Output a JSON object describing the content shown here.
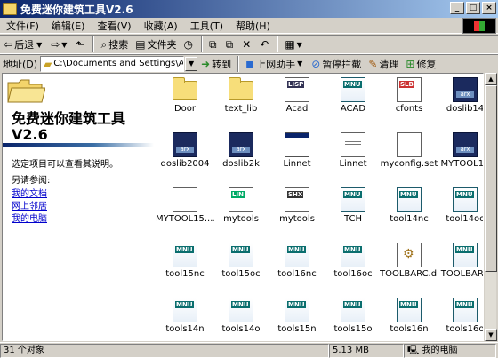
{
  "window": {
    "title": "免费迷你建筑工具V2.6"
  },
  "menu": [
    "文件(F)",
    "编辑(E)",
    "查看(V)",
    "收藏(A)",
    "工具(T)",
    "帮助(H)"
  ],
  "toolbar": {
    "back": "后退",
    "search": "搜索",
    "folders": "文件夹"
  },
  "address": {
    "label": "地址(D)",
    "value": "C:\\Documents and Settings\\Administ",
    "go": "转到",
    "links": [
      "上网助手",
      "暂停拦截",
      "清理",
      "修复"
    ]
  },
  "leftpane": {
    "title": "免费迷你建筑工具 V2.6",
    "desc": "选定项目可以查看其说明。",
    "see_also": "另请参阅:",
    "links": [
      "我的文档",
      "网上邻居",
      "我的电脑"
    ]
  },
  "files": [
    {
      "name": "Door",
      "type": "folder"
    },
    {
      "name": "text_lib",
      "type": "folder"
    },
    {
      "name": "Acad",
      "type": "lisp"
    },
    {
      "name": "ACAD",
      "type": "mnu"
    },
    {
      "name": "cfonts",
      "type": "slb"
    },
    {
      "name": "doslib14",
      "type": "arx"
    },
    {
      "name": "doslib2004",
      "type": "arx"
    },
    {
      "name": "doslib2k",
      "type": "arx"
    },
    {
      "name": "Linnet",
      "type": "window"
    },
    {
      "name": "Linnet",
      "type": "text"
    },
    {
      "name": "myconfig.set",
      "type": "file"
    },
    {
      "name": "MYTOOL14",
      "type": "arx"
    },
    {
      "name": "MYTOOL15....",
      "type": "file"
    },
    {
      "name": "mytools",
      "type": "lin"
    },
    {
      "name": "mytools",
      "type": "shx"
    },
    {
      "name": "TCH",
      "type": "mnu"
    },
    {
      "name": "tool14nc",
      "type": "mnu"
    },
    {
      "name": "tool14oc",
      "type": "mnu"
    },
    {
      "name": "tool15nc",
      "type": "mnu"
    },
    {
      "name": "tool15oc",
      "type": "mnu"
    },
    {
      "name": "tool16nc",
      "type": "mnu"
    },
    {
      "name": "tool16oc",
      "type": "mnu"
    },
    {
      "name": "TOOLBARC.dll",
      "type": "dll"
    },
    {
      "name": "TOOLBARC",
      "type": "mnu"
    },
    {
      "name": "tools14n",
      "type": "mnu"
    },
    {
      "name": "tools14o",
      "type": "mnu"
    },
    {
      "name": "tools15n",
      "type": "mnu"
    },
    {
      "name": "tools15o",
      "type": "mnu"
    },
    {
      "name": "tools16n",
      "type": "mnu"
    },
    {
      "name": "tools16o",
      "type": "mnu"
    }
  ],
  "status": {
    "count": "31 个对象",
    "size": "5.13 MB",
    "location": "我的电脑"
  }
}
